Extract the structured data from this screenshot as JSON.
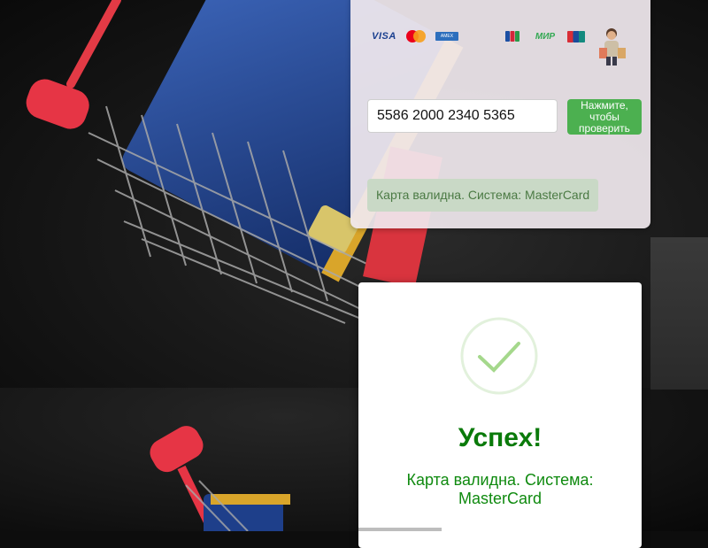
{
  "payment_logos": [
    {
      "name": "VISA",
      "label": "VISA"
    },
    {
      "name": "mastercard-icon",
      "colors": [
        "#eb001b",
        "#f79e1b"
      ]
    },
    {
      "name": "amex-icon",
      "color": "#2d6fbd"
    },
    {
      "name": "jcb-icon"
    },
    {
      "name": "МИР",
      "label": "МИР"
    },
    {
      "name": "unionpay-icon"
    }
  ],
  "card_input": {
    "value": "5586 2000 2340 5365"
  },
  "check_button": {
    "label": "Нажмите, чтобы проверить"
  },
  "inline_result": {
    "text": "Карта валидна. Система: MasterCard"
  },
  "success_modal": {
    "title": "Успех!",
    "message": "Карта валидна. Система: MasterCard"
  },
  "colors": {
    "accent_green": "#4cb050",
    "success_text": "#0a7a0a",
    "panel_bg": "#f0e8ee"
  }
}
